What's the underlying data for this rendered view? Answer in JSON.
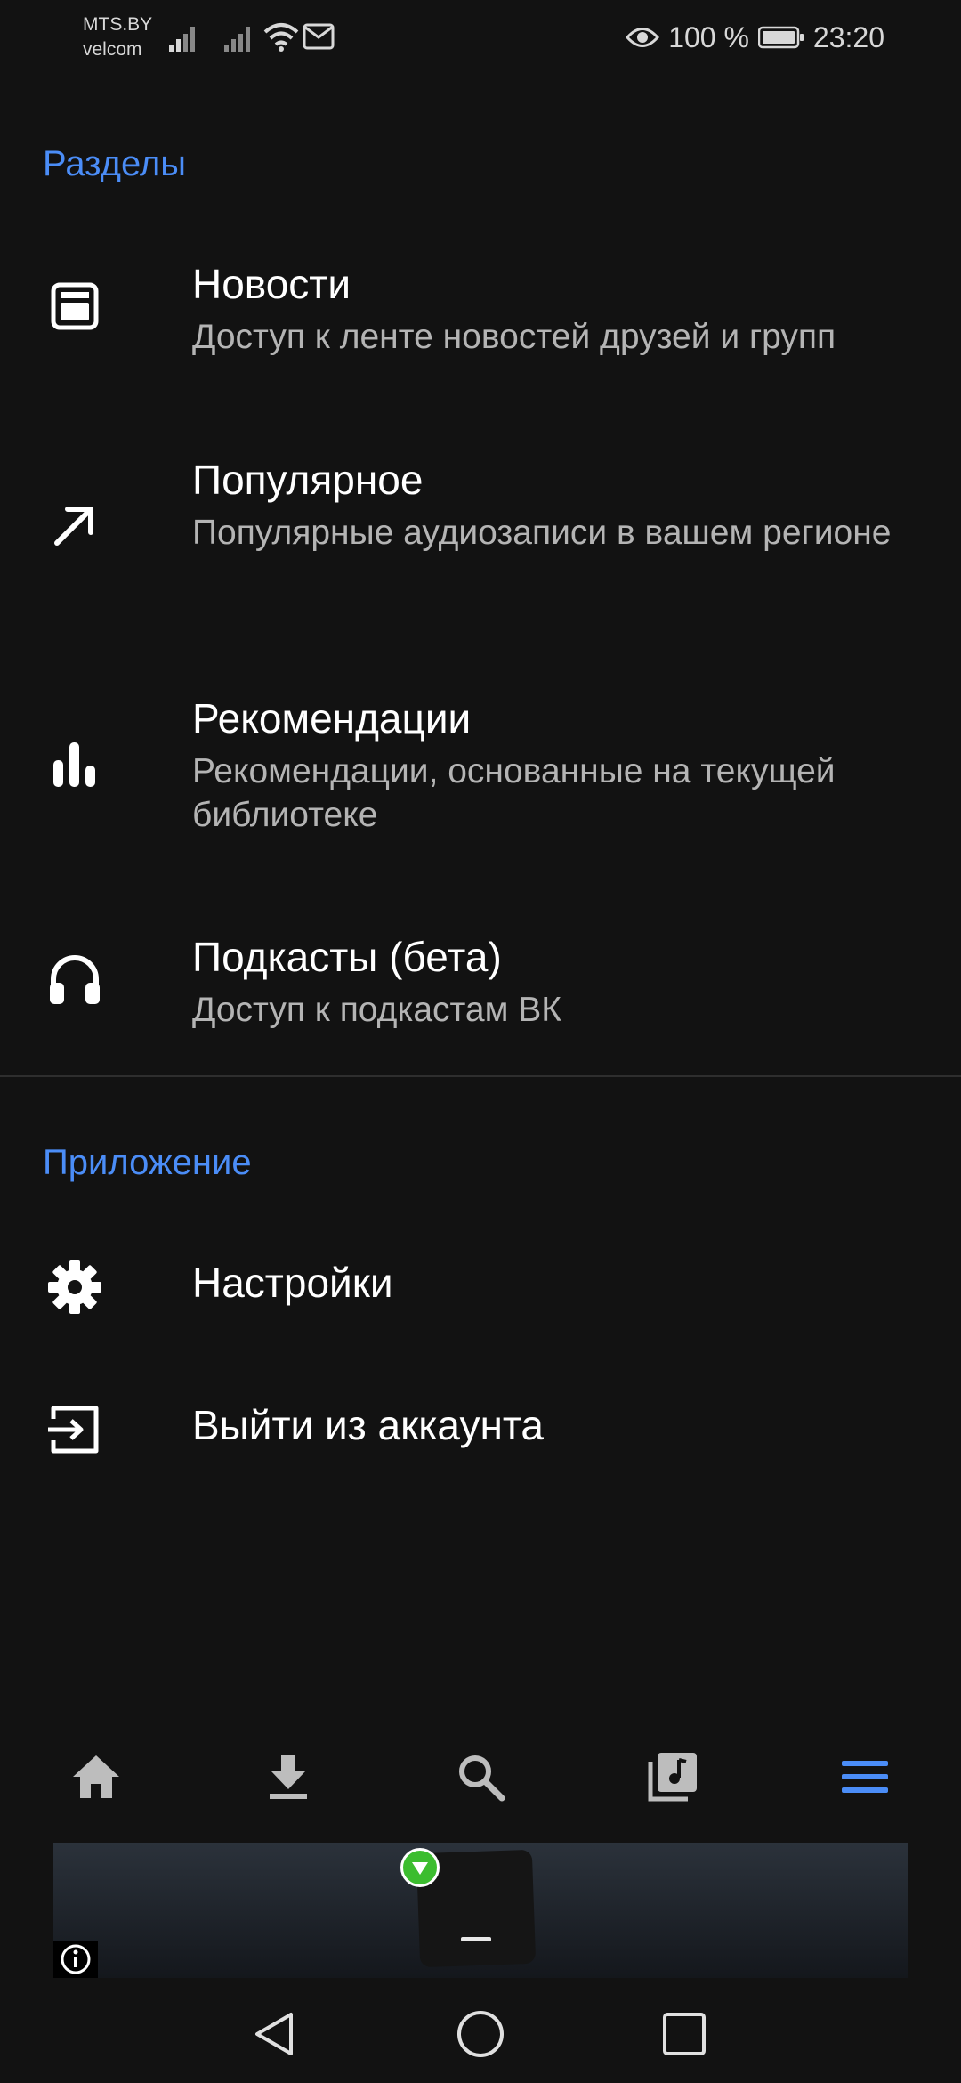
{
  "status_bar": {
    "carrier_1": "MTS.BY",
    "carrier_2": "velcom",
    "battery_percent": "100 %",
    "time": "23:20",
    "icons": [
      "signal-icon",
      "signal-icon",
      "wifi-icon",
      "mail-notification-icon",
      "eye-icon",
      "battery-icon"
    ]
  },
  "sections_header": "Разделы",
  "sections": [
    {
      "icon": "news-icon",
      "title": "Новости",
      "subtitle": "Доступ к ленте новостей друзей и групп"
    },
    {
      "icon": "trending-arrow-icon",
      "title": "Популярное",
      "subtitle": "Популярные аудиозаписи в вашем регионе"
    },
    {
      "icon": "bar-chart-icon",
      "title": "Рекомендации",
      "subtitle": "Рекомендации, основанные на текущей библиотеке"
    },
    {
      "icon": "headphones-icon",
      "title": "Подкасты (бета)",
      "subtitle": "Доступ к подкастам ВК"
    }
  ],
  "app_header": "Приложение",
  "app_items": [
    {
      "icon": "gear-icon",
      "title": "Настройки"
    },
    {
      "icon": "logout-icon",
      "title": "Выйти из аккаунта"
    }
  ],
  "bottom_nav": {
    "items": [
      "home-icon",
      "download-icon",
      "search-icon",
      "music-library-icon",
      "menu-icon"
    ],
    "active": "menu-icon",
    "active_color": "#4b8df7",
    "inactive_color": "#bdbdbd"
  },
  "accent_color": "#4b8df7"
}
